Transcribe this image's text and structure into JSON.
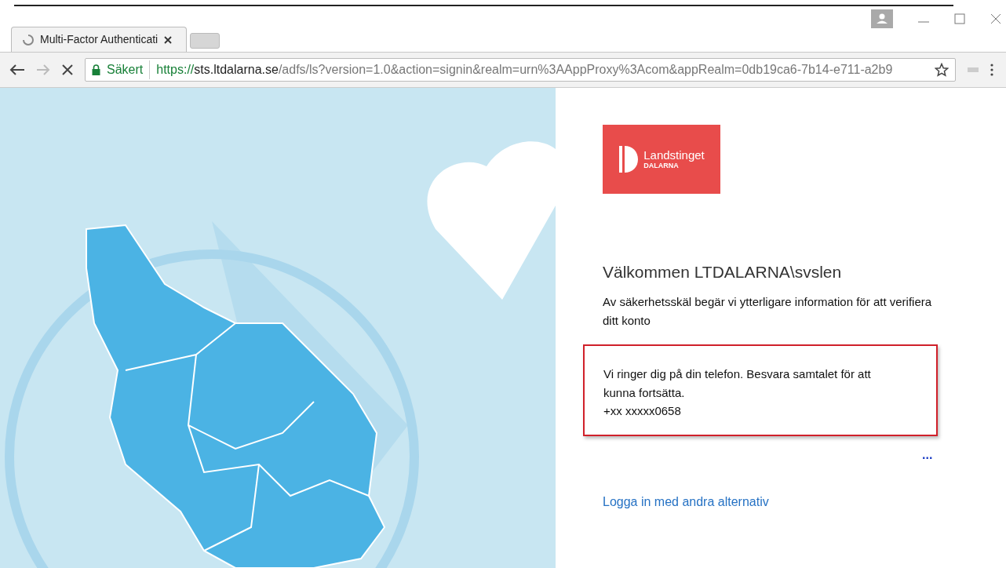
{
  "browser": {
    "tabs": [
      {
        "title": "Multi-Factor Authenticati",
        "loading": true,
        "selected": true
      }
    ],
    "address_bar": {
      "security_label": "Säkert",
      "url_scheme": "https://",
      "url_host": "sts.ltdalarna.se",
      "url_path": "/adfs/ls?version=1.0&action=signin&realm=urn%3AAppProxy%3Acom&appRealm=0db19ca6-7b14-e711-a2b9"
    }
  },
  "page": {
    "logo": {
      "name": "Landstinget",
      "subtitle": "DALARNA"
    },
    "heading": "Välkommen LTDALARNA\\svslen",
    "intro": "Av säkerhetsskäl begär vi ytterligare information för att verifiera ditt konto",
    "notice": {
      "message": "Vi ringer dig på din telefon. Besvara samtalet för att kunna fortsätta.",
      "phone": "+xx xxxxx0658"
    },
    "progress_dots": "...",
    "other_options_link": "Logga in med andra alternativ"
  }
}
